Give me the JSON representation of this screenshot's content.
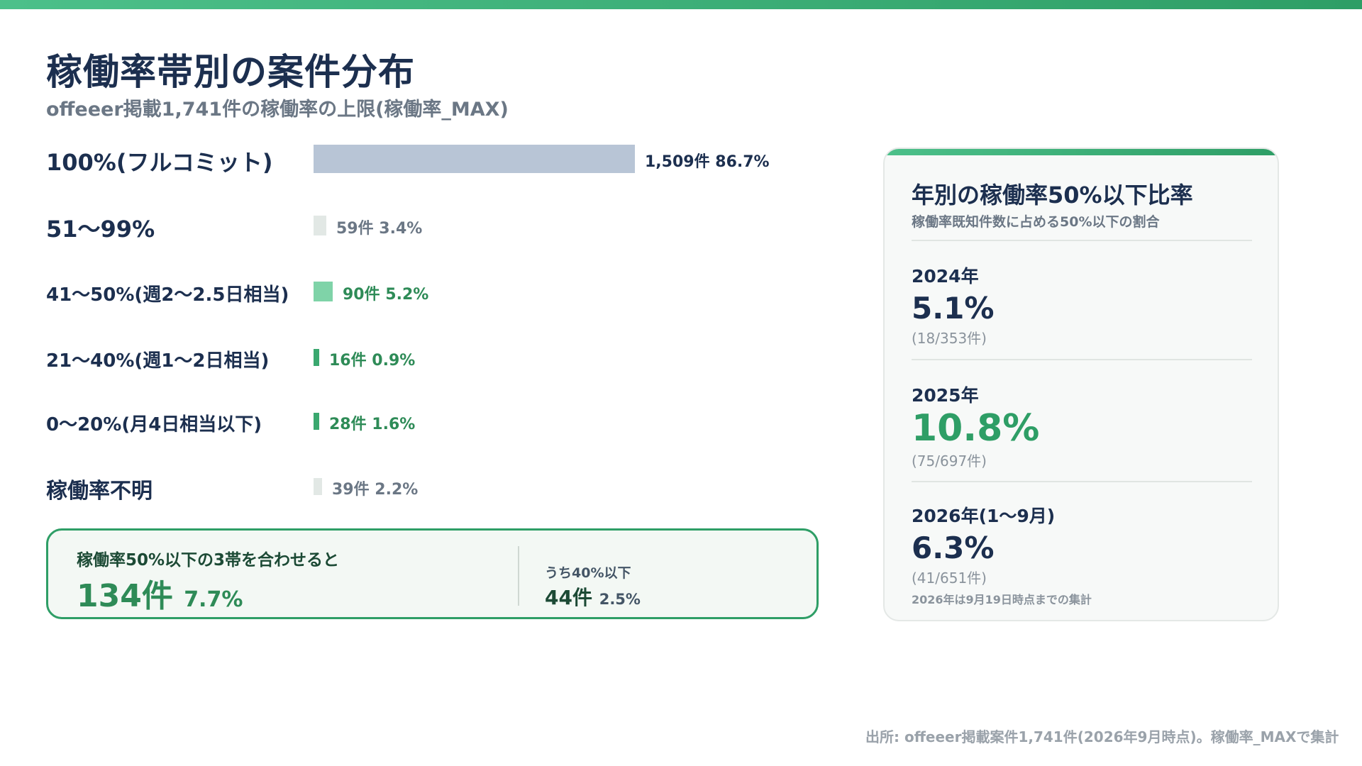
{
  "header": {
    "title": "稼働率帯別の案件分布",
    "subtitle": "offeeer掲載1,741件の稼働率の上限(稼働率_MAX)"
  },
  "chart_data": {
    "type": "bar",
    "orientation": "horizontal",
    "categories": [
      "100%(フルコミット)",
      "51〜99%",
      "41〜50%(週2〜2.5日相当)",
      "21〜40%(週1〜2日相当)",
      "0〜20%(月4日相当以下)",
      "稼働率不明"
    ],
    "values": [
      1509,
      59,
      90,
      16,
      28,
      39
    ],
    "percents": [
      "86.7%",
      "3.4%",
      "5.2%",
      "0.9%",
      "1.6%",
      "2.2%"
    ],
    "count_labels": [
      "1,509件",
      "59件",
      "90件",
      "16件",
      "28件",
      "39件"
    ],
    "value_max": 1509,
    "bar_colors": [
      "#b8c5d6",
      "#e2e8e5",
      "#7fd3a8",
      "#3aa86f",
      "#3aa86f",
      "#e2e8e5"
    ],
    "label_colors": [
      "#1c2f4f",
      "#6b7785",
      "#2e8b57",
      "#2e8b57",
      "#2e8b57",
      "#6b7785"
    ]
  },
  "summary": {
    "label": "稼働率50%以下の3帯を合わせると",
    "count": "134件",
    "percent": "7.7%",
    "sub_label": "うち40%以下",
    "sub_count": "44件",
    "sub_percent": "2.5%"
  },
  "panel": {
    "title": "年別の稼働率50%以下比率",
    "subtitle": "稼働率既知件数に占める50%以下の割合",
    "years": [
      {
        "year": "2024年",
        "value": "5.1%",
        "fraction": "(18/353件)",
        "color": "#1c2f4f"
      },
      {
        "year": "2025年",
        "value": "10.8%",
        "fraction": "(75/697件)",
        "color": "#2e9e66"
      },
      {
        "year": "2026年(1〜9月)",
        "value": "6.3%",
        "fraction": "(41/651件)",
        "color": "#1c2f4f"
      }
    ],
    "note": "2026年は9月19日時点までの集計"
  },
  "footer": {
    "source": "出所: offeeer掲載案件1,741件(2026年9月時点)。稼働率_MAXで集計"
  }
}
